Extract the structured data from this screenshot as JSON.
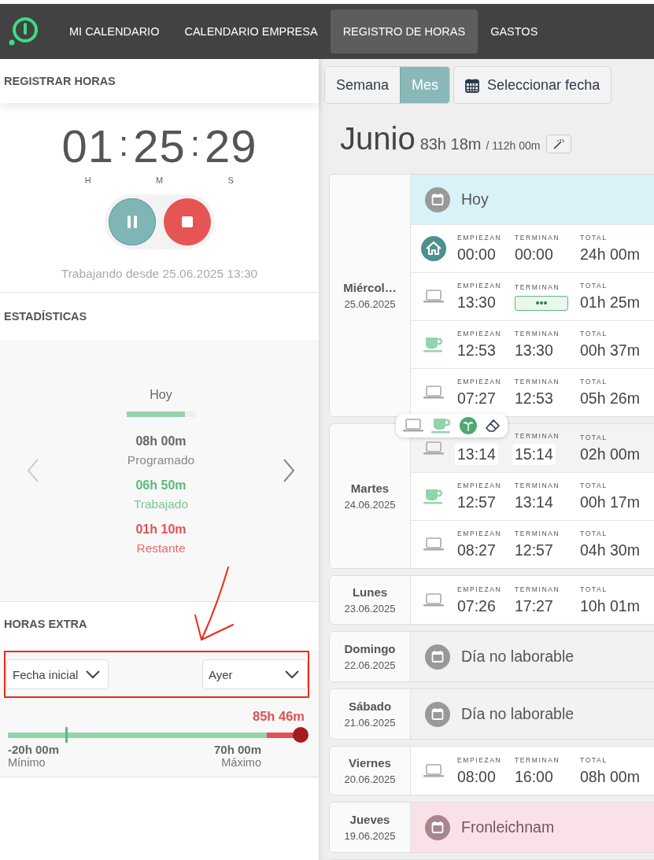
{
  "nav": {
    "items": [
      {
        "label": "MI CALENDARIO",
        "selected": false
      },
      {
        "label": "CALENDARIO EMPRESA",
        "selected": false
      },
      {
        "label": "REGISTRO DE HORAS",
        "selected": true
      },
      {
        "label": "GASTOS",
        "selected": false
      }
    ]
  },
  "register": {
    "title": "REGISTRAR HORAS",
    "timer": [
      {
        "value": "01",
        "unit": "H"
      },
      {
        "value": "25",
        "unit": "M"
      },
      {
        "value": "29",
        "unit": "S"
      }
    ],
    "separators": [
      ":",
      ":"
    ],
    "running": true,
    "status": "Trabajando desde 25.06.2025 13:30"
  },
  "statistics": {
    "title": "ESTADÍSTICAS",
    "period": "Hoy",
    "level": 0.85,
    "values": [
      {
        "kind": "scheduled",
        "value": "08h 00m",
        "label": "Programado"
      },
      {
        "kind": "worked",
        "value": "06h 50m",
        "label": "Trabajado"
      },
      {
        "kind": "remaining",
        "value": "01h 10m",
        "label": "Restante"
      }
    ]
  },
  "overtime": {
    "title": "HORAS EXTRA",
    "from": "Fecha inicial",
    "to": "Ayer",
    "balance": "85h 46m",
    "level": 1,
    "min": {
      "value": "-20h 00m",
      "label": "Mínimo"
    },
    "max": {
      "value": "70h 00m",
      "label": "Máximo"
    }
  },
  "view": {
    "modes": [
      {
        "label": "Semana",
        "selected": false
      },
      {
        "label": "Mes",
        "selected": true
      }
    ],
    "date_button": "Seleccionar fecha"
  },
  "month": {
    "name": "Junio",
    "worked": "83h 18m",
    "target": "/ 112h 00m"
  },
  "days": [
    {
      "name": "Miércol…",
      "date": "25.06.2025",
      "rows": [
        {
          "kind": "event",
          "text": "Hoy",
          "color": "#d9f2f8"
        },
        {
          "kind": "home",
          "start_label": "EMPIEZAN",
          "start": "00:00",
          "end_label": "TERMINAN",
          "end": "00:00",
          "total_label": "TOTAL",
          "total": "24h 00m",
          "running": false,
          "highlighted": false
        },
        {
          "kind": "work",
          "start_label": "EMPIEZAN",
          "start": "13:30",
          "end_label": "TERMINAN",
          "total_label": "TOTAL",
          "total": "01h 25m",
          "running": true,
          "highlighted": false
        },
        {
          "kind": "break",
          "start_label": "EMPIEZAN",
          "start": "12:53",
          "end_label": "TERMINAN",
          "end": "13:30",
          "total_label": "TOTAL",
          "total": "00h 37m",
          "running": false,
          "highlighted": false
        },
        {
          "kind": "work",
          "start_label": "EMPIEZAN",
          "start": "07:27",
          "end_label": "TERMINAN",
          "end": "12:53",
          "total_label": "TOTAL",
          "total": "05h 26m",
          "running": false,
          "highlighted": false
        }
      ]
    },
    {
      "name": "Martes",
      "date": "24.06.2025",
      "menu": true,
      "rows": [
        {
          "kind": "work",
          "start": "13:14",
          "end_label": "TERMINAN",
          "end": "15:14",
          "total_label": "TOTAL",
          "total": "02h 00m",
          "running": false,
          "highlighted": true
        },
        {
          "kind": "break",
          "start_label": "EMPIEZAN",
          "start": "12:57",
          "end_label": "TERMINAN",
          "end": "13:14",
          "total_label": "TOTAL",
          "total": "00h 17m",
          "running": false,
          "highlighted": false
        },
        {
          "kind": "work",
          "start_label": "EMPIEZAN",
          "start": "08:27",
          "end_label": "TERMINAN",
          "end": "12:57",
          "total_label": "TOTAL",
          "total": "04h 30m",
          "running": false,
          "highlighted": false
        }
      ]
    },
    {
      "name": "Lunes",
      "date": "23.06.2025",
      "rows": [
        {
          "kind": "work",
          "start_label": "EMPIEZAN",
          "start": "07:26",
          "end_label": "TERMINAN",
          "end": "17:27",
          "total_label": "TOTAL",
          "total": "10h 01m",
          "running": false,
          "highlighted": false
        }
      ]
    },
    {
      "name": "Domingo",
      "date": "22.06.2025",
      "rows": [
        {
          "kind": "event",
          "text": "Día no laborable",
          "color": "#f2f2f2"
        }
      ]
    },
    {
      "name": "Sábado",
      "date": "21.06.2025",
      "rows": [
        {
          "kind": "event",
          "text": "Día no laborable",
          "color": "#f2f2f2"
        }
      ]
    },
    {
      "name": "Viernes",
      "date": "20.06.2025",
      "rows": [
        {
          "kind": "work",
          "start_label": "EMPIEZAN",
          "start": "08:00",
          "end_label": "TERMINAN",
          "end": "16:00",
          "total_label": "TOTAL",
          "total": "08h 00m",
          "running": false,
          "highlighted": false
        }
      ]
    },
    {
      "name": "Jueves",
      "date": "19.06.2025",
      "rows": [
        {
          "kind": "event",
          "text": "Fronleichnam",
          "color": "#fae1e8"
        }
      ]
    }
  ]
}
